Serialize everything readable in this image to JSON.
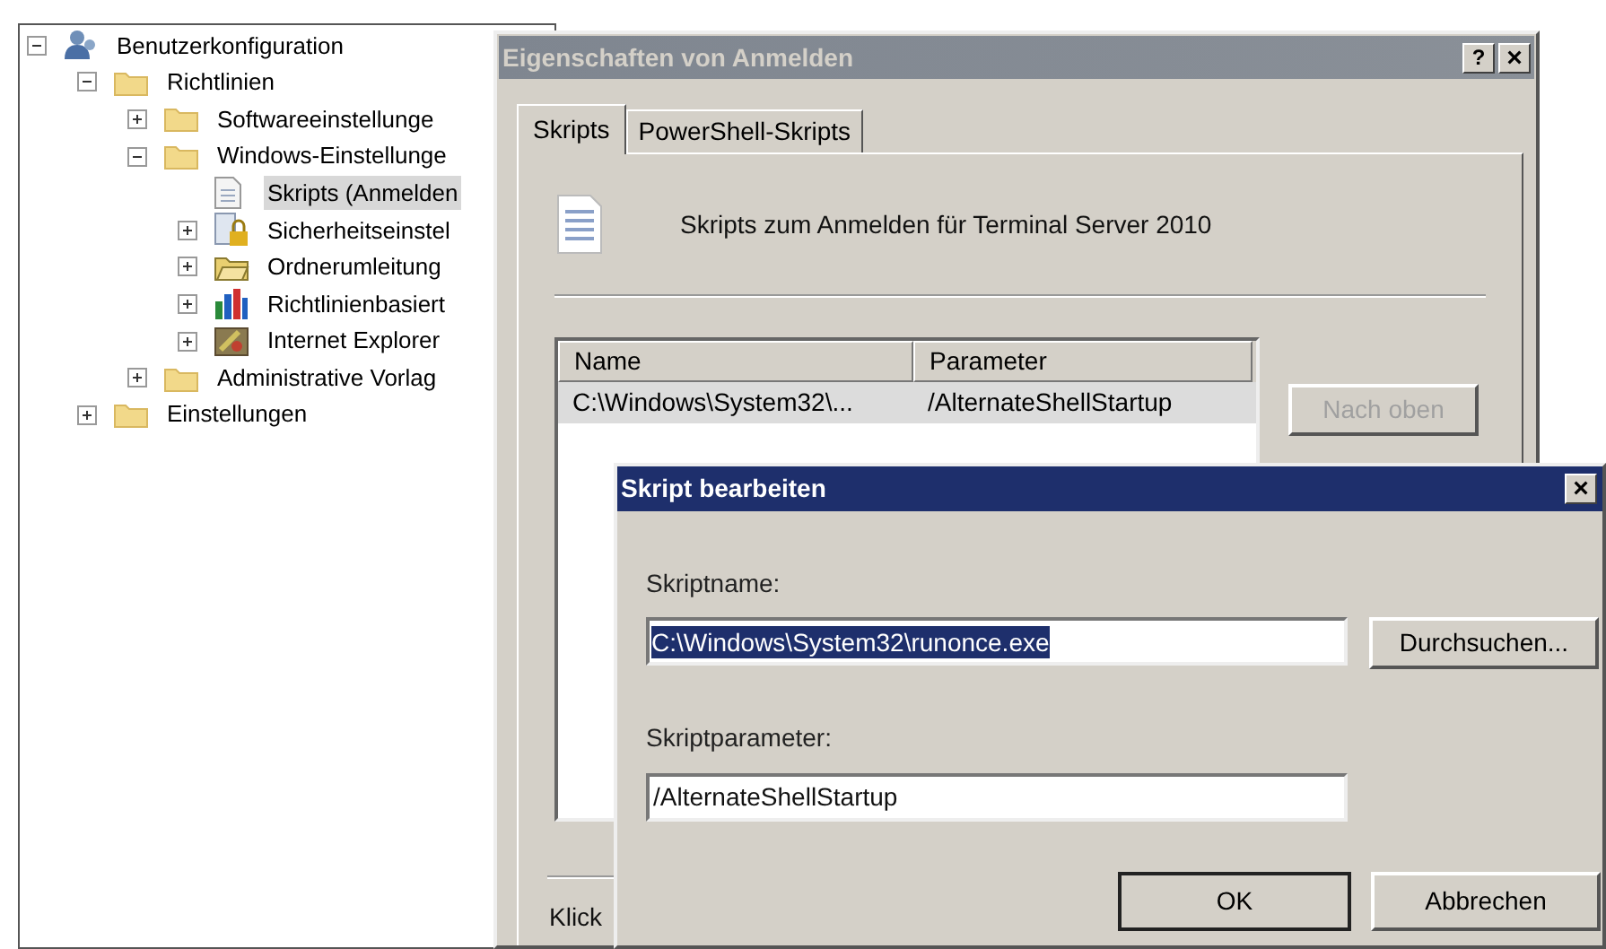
{
  "tree": [
    {
      "label": "Benutzerkonfiguration",
      "kind": "user",
      "expanded": true,
      "selected": false,
      "children": [
        {
          "label": "Richtlinien",
          "kind": "folder",
          "expanded": true,
          "selected": false,
          "children": [
            {
              "label": "Softwareeinstellunge",
              "kind": "folder",
              "expanded": false,
              "selected": false
            },
            {
              "label": "Windows-Einstellunge",
              "kind": "folder",
              "expanded": true,
              "selected": false,
              "children": [
                {
                  "label": "Skripts (Anmelden",
                  "kind": "script",
                  "selected": true
                },
                {
                  "label": "Sicherheitseinstel",
                  "kind": "security",
                  "expanded": false,
                  "selected": false
                },
                {
                  "label": "Ordnerumleitung",
                  "kind": "folder-open",
                  "expanded": false,
                  "selected": false
                },
                {
                  "label": "Richtlinienbasiert",
                  "kind": "chart",
                  "expanded": false,
                  "selected": false
                },
                {
                  "label": "Internet Explorer",
                  "kind": "tools",
                  "expanded": false,
                  "selected": false
                }
              ]
            },
            {
              "label": "Administrative Vorlag",
              "kind": "folder",
              "expanded": false,
              "selected": false
            }
          ]
        },
        {
          "label": "Einstellungen",
          "kind": "folder",
          "expanded": false,
          "selected": false
        }
      ]
    }
  ],
  "properties_dialog": {
    "title": "Eigenschaften von Anmelden",
    "help": "?",
    "close": "×",
    "tabs": [
      {
        "label": "Skripts",
        "selected": true
      },
      {
        "label": "PowerShell-Skripts",
        "selected": false
      }
    ],
    "heading": "Skripts zum Anmelden für Terminal Server 2010",
    "columns": [
      "Name",
      "Parameter"
    ],
    "rows": [
      {
        "cells": [
          "C:\\Windows\\System32\\...",
          "/AlternateShellStartup"
        ],
        "selected": true
      }
    ],
    "button": {
      "label": "Nach oben",
      "disabled": true
    },
    "footer": "Klick"
  },
  "edit_dialog": {
    "title": "Skript bearbeiten",
    "close": "×",
    "name_label": "Skriptname:",
    "name_value": "C:\\Windows\\System32\\runonce.exe",
    "name_selected": true,
    "browse": "Durchsuchen...",
    "param_label": "Skriptparameter:",
    "param_value": "/AlternateShellStartup",
    "buttons": [
      "OK",
      "Abbrechen"
    ]
  }
}
